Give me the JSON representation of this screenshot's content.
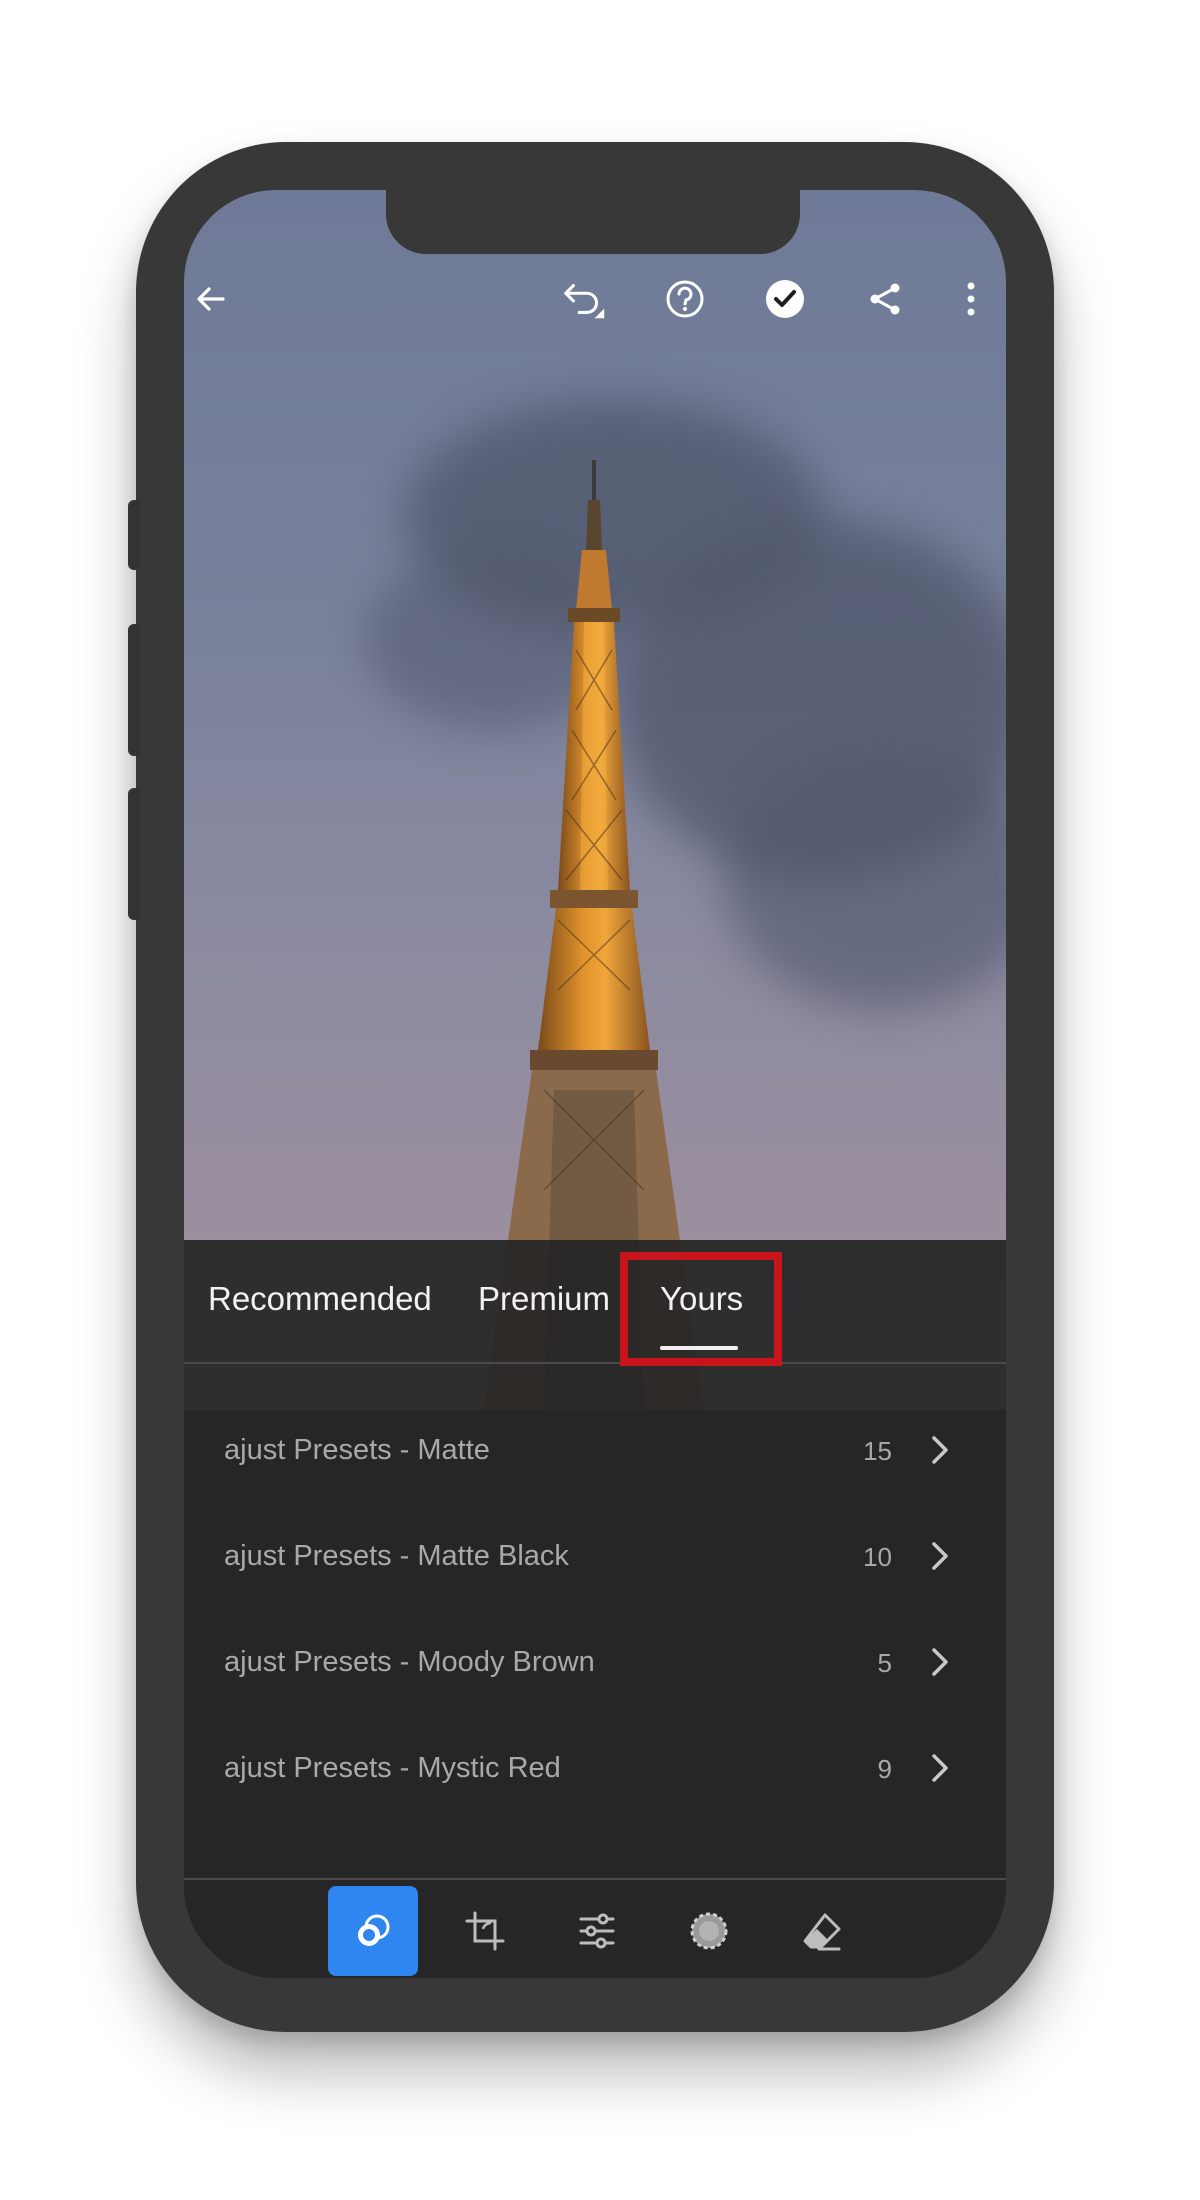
{
  "topbar": {
    "icons": [
      "back-arrow-icon",
      "undo-icon",
      "help-icon",
      "check-icon",
      "share-icon",
      "more-vert-icon"
    ]
  },
  "tabs": {
    "items": [
      {
        "label": "Recommended"
      },
      {
        "label": "Premium"
      },
      {
        "label": "Yours"
      }
    ],
    "selected": "Yours"
  },
  "presets": [
    {
      "name": "ajust Presets - Matte",
      "count": "15"
    },
    {
      "name": "ajust Presets - Matte Black",
      "count": "10"
    },
    {
      "name": "ajust Presets - Moody Brown",
      "count": "5"
    },
    {
      "name": "ajust Presets - Mystic Red",
      "count": "9"
    }
  ],
  "bottom_toolbar": {
    "tools": [
      "presets-icon",
      "crop-icon",
      "adjust-sliders-icon",
      "selective-icon",
      "eraser-icon"
    ],
    "active": "presets-icon"
  },
  "colors": {
    "accent": "#2f86f0",
    "highlight": "#c8141a"
  }
}
